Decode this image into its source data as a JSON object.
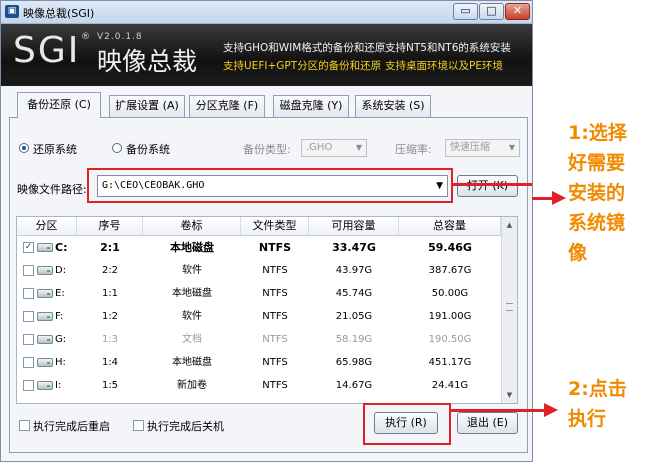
{
  "window": {
    "title": "映像总裁(SGI)",
    "minimize_glyph": "▭",
    "maximize_glyph": "□",
    "close_glyph": "✕"
  },
  "banner": {
    "logo": "SGI",
    "registered": "®",
    "version": "V2.0.1.8",
    "brand_cn": "映像总裁",
    "features": [
      {
        "text": "支持GHO和WIM格式的备份和还原",
        "color": "white"
      },
      {
        "text": "支持NT5和NT6的系统安装",
        "color": "white"
      },
      {
        "text": "支持UEFI+GPT分区的备份和还原",
        "color": "yellow"
      },
      {
        "text": "支持桌面环境以及PE环境",
        "color": "yellow"
      }
    ]
  },
  "tabs": [
    {
      "label": "备份还原 (C)",
      "active": true
    },
    {
      "label": "扩展设置 (A)",
      "active": false
    },
    {
      "label": "分区克隆 (F)",
      "active": false
    },
    {
      "label": "磁盘克隆 (Y)",
      "active": false
    },
    {
      "label": "系统安装 (S)",
      "active": false
    }
  ],
  "options": {
    "restore_label": "还原系统",
    "backup_label": "备份系统",
    "backup_type_label": "备份类型:",
    "backup_type_value": ".GHO",
    "compression_label": "压缩率:",
    "compression_value": "快速压缩"
  },
  "path": {
    "label": "映像文件路径:",
    "value": "G:\\CEO\\CEOBAK.GHO",
    "open_button": "打开 (K)"
  },
  "table": {
    "headers": [
      "分区",
      "序号",
      "卷标",
      "文件类型",
      "可用容量",
      "总容量"
    ],
    "rows": [
      {
        "drive": "C:",
        "index": "2:1",
        "label": "本地磁盘",
        "fs": "NTFS",
        "free": "33.47G",
        "total": "59.46G",
        "checked": true,
        "selected": true,
        "dim": false
      },
      {
        "drive": "D:",
        "index": "2:2",
        "label": "软件",
        "fs": "NTFS",
        "free": "43.97G",
        "total": "387.67G",
        "checked": false,
        "selected": false,
        "dim": false
      },
      {
        "drive": "E:",
        "index": "1:1",
        "label": "本地磁盘",
        "fs": "NTFS",
        "free": "45.74G",
        "total": "50.00G",
        "checked": false,
        "selected": false,
        "dim": false
      },
      {
        "drive": "F:",
        "index": "1:2",
        "label": "软件",
        "fs": "NTFS",
        "free": "21.05G",
        "total": "191.00G",
        "checked": false,
        "selected": false,
        "dim": false
      },
      {
        "drive": "G:",
        "index": "1:3",
        "label": "文档",
        "fs": "NTFS",
        "free": "58.19G",
        "total": "190.50G",
        "checked": false,
        "selected": false,
        "dim": true
      },
      {
        "drive": "H:",
        "index": "1:4",
        "label": "本地磁盘",
        "fs": "NTFS",
        "free": "65.98G",
        "total": "451.17G",
        "checked": false,
        "selected": false,
        "dim": false
      },
      {
        "drive": "I:",
        "index": "1:5",
        "label": "新加卷",
        "fs": "NTFS",
        "free": "14.67G",
        "total": "24.41G",
        "checked": false,
        "selected": false,
        "dim": false
      }
    ]
  },
  "footer": {
    "reboot_label": "执行完成后重启",
    "shutdown_label": "执行完成后关机",
    "execute_button": "执行 (R)",
    "exit_button": "退出 (E)"
  },
  "annotations": {
    "step1": [
      "1:选择",
      "好需要",
      "安装的",
      "系统镜",
      "像"
    ],
    "step2": [
      "2:点击",
      "执行"
    ]
  },
  "colors": {
    "highlight": "#e0212a",
    "annotation_text": "#f08a00",
    "feature_yellow": "#f2d11e"
  }
}
